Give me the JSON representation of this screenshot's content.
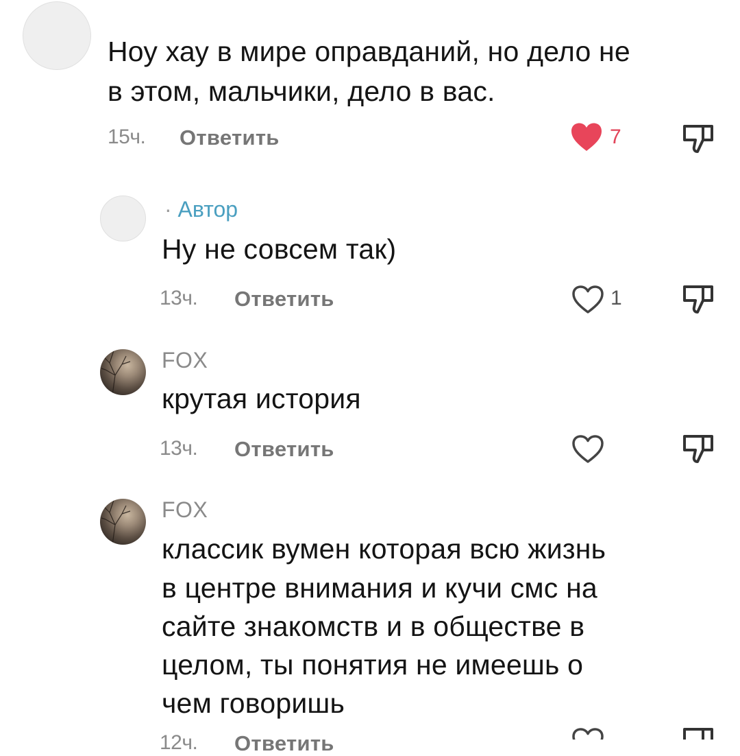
{
  "comments": [
    {
      "author": "",
      "author_tag": "",
      "text_lines": [
        "Ноу хау в мире оправданий, но дело не",
        "в этом, мальчики, дело в вас."
      ],
      "time": "15ч.",
      "reply_label": "Ответить",
      "likes": "7",
      "liked": true
    },
    {
      "author": "",
      "author_tag": "Автор",
      "text_lines": [
        "Ну не совсем так)"
      ],
      "time": "13ч.",
      "reply_label": "Ответить",
      "likes": "1",
      "liked": false
    },
    {
      "author": "FOX",
      "author_tag": "",
      "text_lines": [
        "крутая история"
      ],
      "time": "13ч.",
      "reply_label": "Ответить",
      "likes": "",
      "liked": false
    },
    {
      "author": "FOX",
      "author_tag": "",
      "text_lines": [
        "классик вумен которая всю жизнь",
        "в центре внимания и кучи смс на",
        "сайте знакомств и в обществе в",
        "целом, ты понятия не имеешь о",
        "чем говоришь"
      ],
      "time": "12ч.",
      "reply_label": "Ответить",
      "likes": "",
      "liked": false
    }
  ],
  "icons": {
    "like": "heart-icon",
    "dislike": "thumbs-down-icon"
  },
  "colors": {
    "liked_heart": "#e8455a",
    "author_tag": "#4a9fc0"
  }
}
